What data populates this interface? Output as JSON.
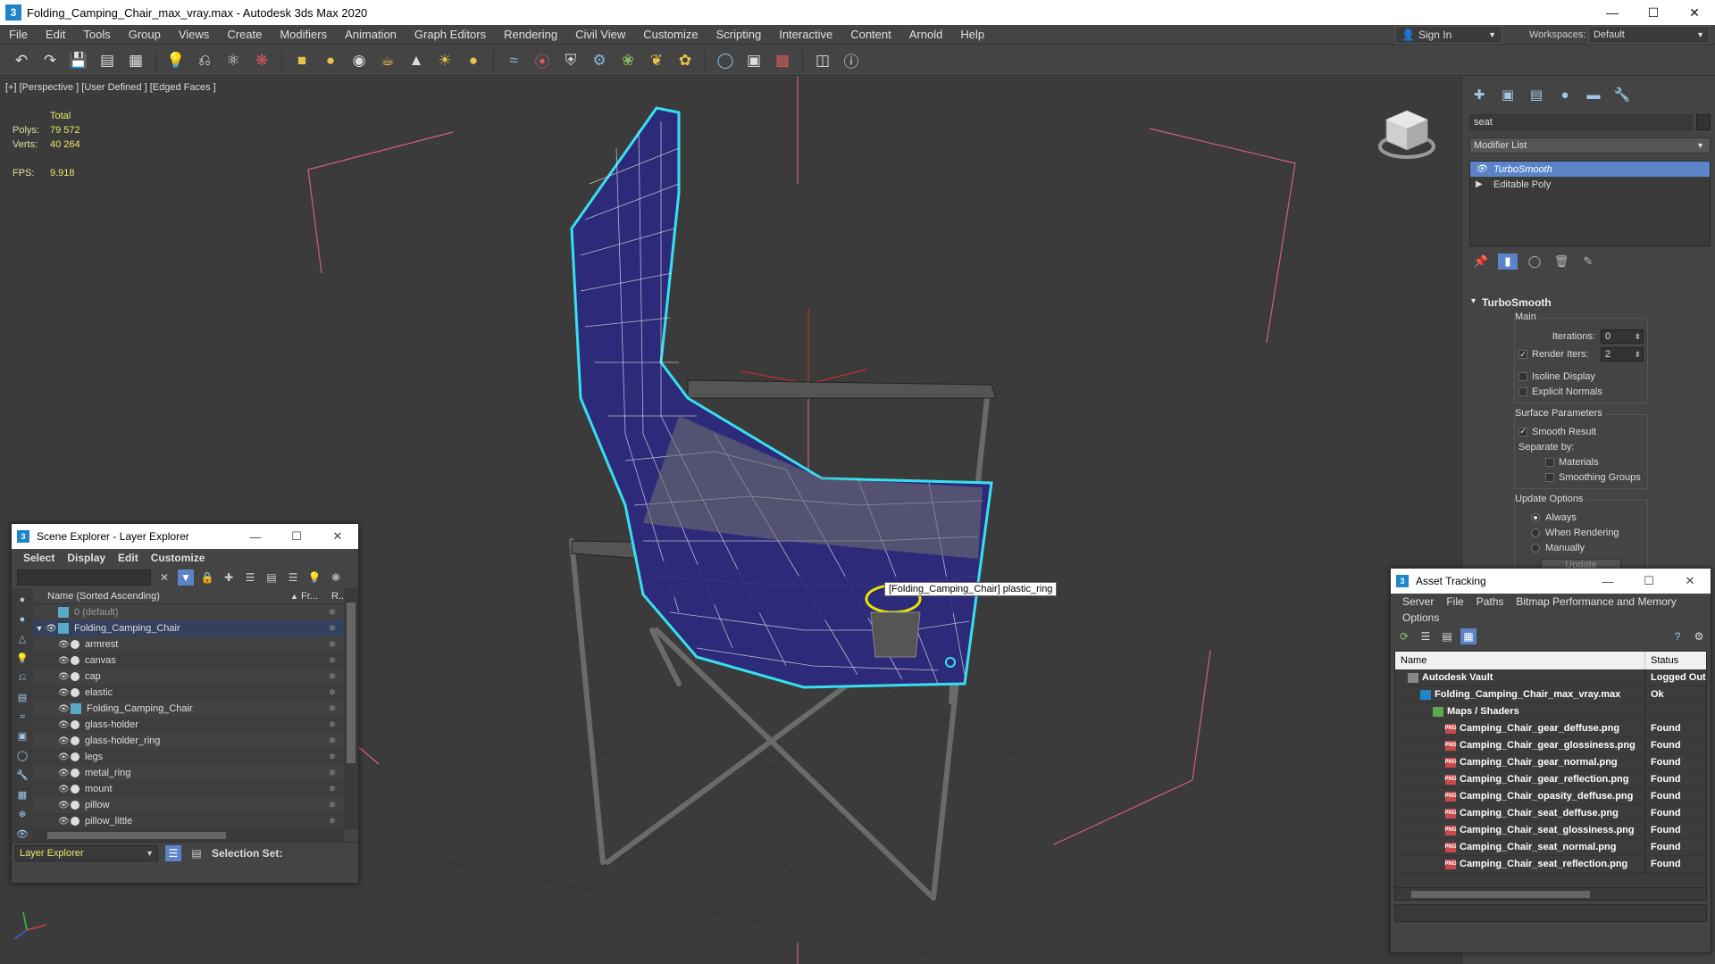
{
  "app": {
    "title": "Folding_Camping_Chair_max_vray.max - Autodesk 3ds Max 2020",
    "icon_label": "3"
  },
  "menu": [
    "File",
    "Edit",
    "Tools",
    "Group",
    "Views",
    "Create",
    "Modifiers",
    "Animation",
    "Graph Editors",
    "Rendering",
    "Civil View",
    "Customize",
    "Scripting",
    "Interactive",
    "Content",
    "Arnold",
    "Help"
  ],
  "signin": {
    "label": "Sign In"
  },
  "workspaces": {
    "label": "Workspaces:",
    "value": "Default"
  },
  "viewport": {
    "label": "[+] [Perspective ] [User Defined ] [Edged Faces ]",
    "stats": {
      "header": "Total",
      "polys_label": "Polys:",
      "polys": "79 572",
      "verts_label": "Verts:",
      "verts": "40 264",
      "fps_label": "FPS:",
      "fps": "9.918"
    },
    "tooltip": "[Folding_Camping_Chair] plastic_ring"
  },
  "command_panel": {
    "object_name": "seat",
    "modifier_list": "Modifier List",
    "stack": [
      {
        "label": "TurboSmooth",
        "selected": true
      },
      {
        "label": "Editable Poly",
        "selected": false
      }
    ],
    "turbosmooth": {
      "title": "TurboSmooth",
      "main_group": "Main",
      "iterations_label": "Iterations:",
      "iterations": "0",
      "render_iters_label": "Render Iters:",
      "render_iters": "2",
      "isoline": "Isoline Display",
      "explicit_normals": "Explicit Normals",
      "surface_group": "Surface Parameters",
      "smooth_result": "Smooth Result",
      "separate_by": "Separate by:",
      "materials": "Materials",
      "smoothing_groups": "Smoothing Groups",
      "update_group": "Update Options",
      "always": "Always",
      "when_rendering": "When Rendering",
      "manually": "Manually",
      "update_btn": "Update"
    }
  },
  "scene_explorer": {
    "title": "Scene Explorer - Layer Explorer",
    "menu": [
      "Select",
      "Display",
      "Edit",
      "Customize"
    ],
    "col_name": "Name (Sorted Ascending)",
    "col_fr": "Fr...",
    "col_r": "R...",
    "rows": [
      {
        "name": "0 (default)",
        "level": 0,
        "type": "layer",
        "dim": true
      },
      {
        "name": "Folding_Camping_Chair",
        "level": 0,
        "type": "layer",
        "selected": true
      },
      {
        "name": "armrest",
        "level": 1,
        "type": "obj"
      },
      {
        "name": "canvas",
        "level": 1,
        "type": "obj"
      },
      {
        "name": "cap",
        "level": 1,
        "type": "obj"
      },
      {
        "name": "elastic",
        "level": 1,
        "type": "obj"
      },
      {
        "name": "Folding_Camping_Chair",
        "level": 1,
        "type": "grp"
      },
      {
        "name": "glass-holder",
        "level": 1,
        "type": "obj"
      },
      {
        "name": "glass-holder_ring",
        "level": 1,
        "type": "obj"
      },
      {
        "name": "legs",
        "level": 1,
        "type": "obj"
      },
      {
        "name": "metal_ring",
        "level": 1,
        "type": "obj"
      },
      {
        "name": "mount",
        "level": 1,
        "type": "obj"
      },
      {
        "name": "pillow",
        "level": 1,
        "type": "obj"
      },
      {
        "name": "pillow_little",
        "level": 1,
        "type": "obj"
      }
    ],
    "layer_dropdown": "Layer Explorer",
    "selection_set": "Selection Set:"
  },
  "asset_tracking": {
    "title": "Asset Tracking",
    "menu": [
      "Server",
      "File",
      "Paths",
      "Bitmap Performance and Memory",
      "Options"
    ],
    "col_name": "Name",
    "col_status": "Status",
    "rows": [
      {
        "name": "Autodesk Vault",
        "status": "Logged Out",
        "indent": 1,
        "icon": "vault"
      },
      {
        "name": "Folding_Camping_Chair_max_vray.max",
        "status": "Ok",
        "indent": 2,
        "icon": "max"
      },
      {
        "name": "Maps / Shaders",
        "status": "",
        "indent": 3,
        "icon": "maps"
      },
      {
        "name": "Camping_Chair_gear_deffuse.png",
        "status": "Found",
        "indent": 4,
        "icon": "png"
      },
      {
        "name": "Camping_Chair_gear_glossiness.png",
        "status": "Found",
        "indent": 4,
        "icon": "png"
      },
      {
        "name": "Camping_Chair_gear_normal.png",
        "status": "Found",
        "indent": 4,
        "icon": "png"
      },
      {
        "name": "Camping_Chair_gear_reflection.png",
        "status": "Found",
        "indent": 4,
        "icon": "png"
      },
      {
        "name": "Camping_Chair_opasity_deffuse.png",
        "status": "Found",
        "indent": 4,
        "icon": "png"
      },
      {
        "name": "Camping_Chair_seat_deffuse.png",
        "status": "Found",
        "indent": 4,
        "icon": "png"
      },
      {
        "name": "Camping_Chair_seat_glossiness.png",
        "status": "Found",
        "indent": 4,
        "icon": "png"
      },
      {
        "name": "Camping_Chair_seat_normal.png",
        "status": "Found",
        "indent": 4,
        "icon": "png"
      },
      {
        "name": "Camping_Chair_seat_reflection.png",
        "status": "Found",
        "indent": 4,
        "icon": "png"
      }
    ],
    "png_badge": "PNG"
  },
  "colors": {
    "selection_blue": "#5b84c8",
    "stats_yellow": "#e8e86a",
    "chair_canvas": "#2e2a7a",
    "selection_outline": "#36e0f0",
    "gizmo_pink": "#d4607a"
  }
}
